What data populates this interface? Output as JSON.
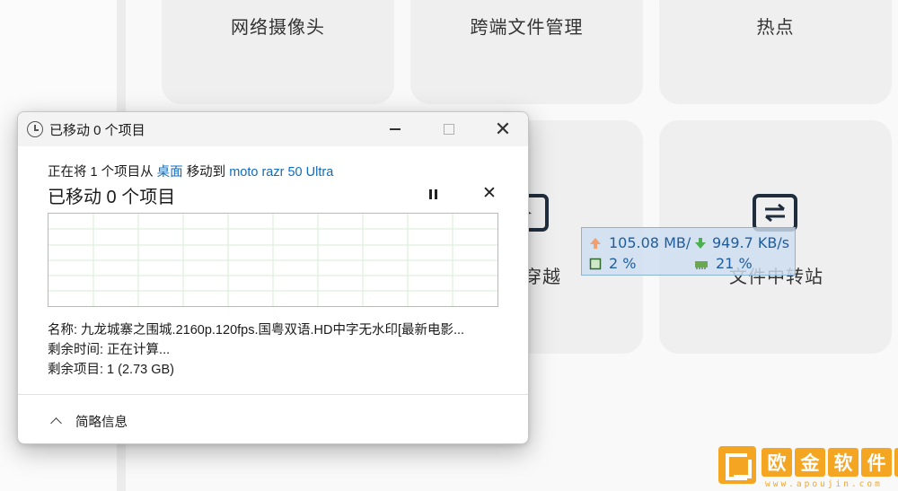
{
  "background_tiles": [
    {
      "label": "网络摄像头"
    },
    {
      "label": "跨端文件管理"
    },
    {
      "label": "热点"
    },
    {
      "label": "穿越"
    },
    {
      "label": "文件中转站"
    }
  ],
  "net_monitor": {
    "upload": "105.08 MB/",
    "download": "949.7 KB/s",
    "cpu": "2 %",
    "memory": "21 %",
    "colors": {
      "upload_arrow": "#f0a070",
      "download_arrow": "#4caf50",
      "text": "#1f5d9c"
    }
  },
  "dialog": {
    "title": "已移动 0 个项目",
    "status_prefix": "正在将 1 个项目从",
    "source_link": "桌面",
    "status_mid": "移动到",
    "dest_link": "moto razr 50 Ultra",
    "heading": "已移动 0 个项目",
    "name_line": "名称: 九龙城寨之围城.2160p.120fps.国粤双语.HD中字无水印[最新电影...",
    "time_line": "剩余时间: 正在计算...",
    "items_line": "剩余项目: 1 (2.73 GB)",
    "details_label": "简略信息",
    "progress": 0
  },
  "watermark": {
    "chars": [
      "欧",
      "金",
      "软",
      "件",
      "园"
    ],
    "url": "www.apoujin.com"
  }
}
